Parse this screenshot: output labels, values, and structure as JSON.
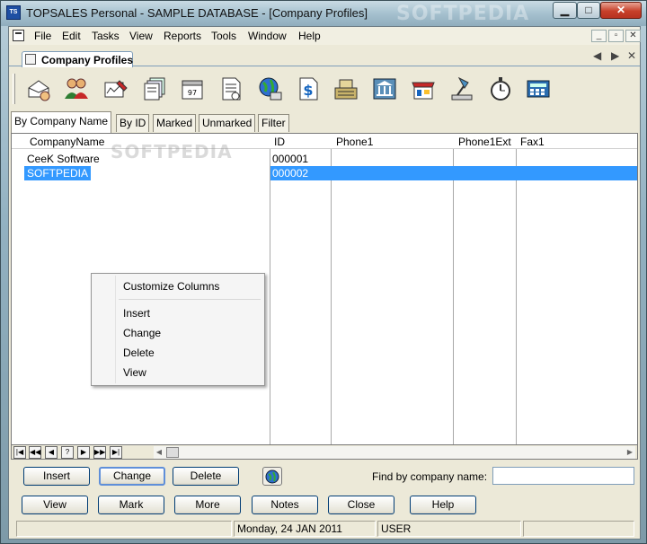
{
  "window": {
    "title": "TOPSALES Personal - SAMPLE DATABASE - [Company Profiles]",
    "watermark": "SOFTPEDIA",
    "minimize_glyph": "▁",
    "maximize_glyph": "□",
    "close_glyph": "✕"
  },
  "menu": {
    "items": [
      "File",
      "Edit",
      "Tasks",
      "View",
      "Reports",
      "Tools",
      "Window",
      "Help"
    ],
    "mdi_controls": [
      "_",
      "▫",
      "✕"
    ]
  },
  "doc_tab": {
    "label": "Company Profiles",
    "nav": [
      "◀",
      "▶",
      "✕"
    ]
  },
  "toolbar": {
    "icons": [
      "envelope-hand-icon",
      "contacts-people-icon",
      "edit-form-icon",
      "stacked-cards-icon",
      "calendar-icon",
      "document-list-icon",
      "world-computer-icon",
      "dollar-document-icon",
      "cash-register-icon",
      "bank-icon",
      "shop-stall-icon",
      "desk-lamp-icon",
      "stopwatch-icon",
      "calculator-icon"
    ]
  },
  "view_tabs": [
    "By Company Name",
    "By ID",
    "Marked",
    "Unmarked",
    "Filter"
  ],
  "grid": {
    "columns": [
      "CompanyName",
      "ID",
      "Phone1",
      "Phone1Ext",
      "Fax1"
    ],
    "watermark": "SOFTPEDIA",
    "rows": [
      {
        "name": "CeeK Software",
        "id": "000001",
        "phone1": "",
        "phone1ext": "",
        "fax1": ""
      },
      {
        "name": "SOFTPEDIA",
        "id": "000002",
        "phone1": "",
        "phone1ext": "",
        "fax1": ""
      }
    ],
    "selected_row": 1
  },
  "context_menu": {
    "items": [
      "Customize Columns",
      "Insert",
      "Change",
      "Delete",
      "View"
    ]
  },
  "record_nav": [
    "|◀",
    "◀◀",
    "◀",
    "?",
    "▶",
    "▶▶",
    "▶|"
  ],
  "scrollbar": {
    "left": "◀",
    "right": "▶"
  },
  "buttons_row1": {
    "insert": "Insert",
    "change": "Change",
    "delete": "Delete",
    "find_label": "Find by company name:",
    "find_value": ""
  },
  "buttons_row2": [
    "View",
    "Mark",
    "More",
    "Notes",
    "Close",
    "Help"
  ],
  "status": {
    "panel1": "",
    "date": "Monday, 24 JAN 2011",
    "user": "USER",
    "panel4": ""
  },
  "colors": {
    "selection": "#3399ff",
    "window_chrome": "#a6c1cf",
    "face": "#ece9d8"
  }
}
